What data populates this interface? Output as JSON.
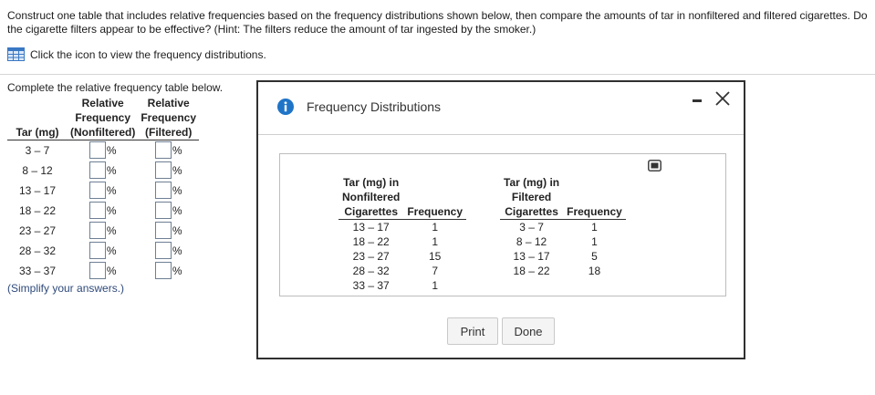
{
  "question": {
    "text": "Construct one table that includes relative frequencies based on the frequency distributions shown below, then compare the amounts of tar in nonfiltered and filtered cigarettes. Do the cigarette filters appear to be effective? (Hint: The filters reduce the amount of tar ingested by the smoker.)",
    "icon_prompt": "Click the icon to view the frequency distributions.",
    "icon": "table-grid-icon"
  },
  "rel_table": {
    "instruction": "Complete the relative frequency table below.",
    "headers": {
      "rel1": "Relative",
      "rel2": "Relative",
      "freq1": "Frequency",
      "freq2": "Frequency",
      "class": "Tar (mg)",
      "nonfiltered": "(Nonfiltered)",
      "filtered": "(Filtered)"
    },
    "rows": [
      {
        "class": "3 – 7",
        "nonfiltered": "",
        "filtered": ""
      },
      {
        "class": "8 – 12",
        "nonfiltered": "",
        "filtered": ""
      },
      {
        "class": "13 – 17",
        "nonfiltered": "",
        "filtered": ""
      },
      {
        "class": "18 – 22",
        "nonfiltered": "",
        "filtered": ""
      },
      {
        "class": "23 – 27",
        "nonfiltered": "",
        "filtered": ""
      },
      {
        "class": "28 – 32",
        "nonfiltered": "",
        "filtered": ""
      },
      {
        "class": "33 – 37",
        "nonfiltered": "",
        "filtered": ""
      }
    ],
    "unit": "%",
    "simplify": "(Simplify your answers.)"
  },
  "dialog": {
    "title": "Frequency Distributions",
    "icons": {
      "info": "info-icon",
      "minimize": "minimize-icon",
      "close": "close-icon",
      "expand": "expand-icon"
    },
    "nonfiltered": {
      "col1": [
        "Tar (mg) in",
        "Nonfiltered",
        "Cigarettes"
      ],
      "col2": "Frequency",
      "rows": [
        {
          "class": "13 – 17",
          "freq": "1"
        },
        {
          "class": "18 – 22",
          "freq": "1"
        },
        {
          "class": "23 – 27",
          "freq": "15"
        },
        {
          "class": "28 – 32",
          "freq": "7"
        },
        {
          "class": "33 – 37",
          "freq": "1"
        }
      ]
    },
    "filtered": {
      "col1": [
        "Tar (mg) in",
        "Filtered",
        "Cigarettes"
      ],
      "col2": "Frequency",
      "rows": [
        {
          "class": "3 – 7",
          "freq": "1"
        },
        {
          "class": "8 – 12",
          "freq": "1"
        },
        {
          "class": "13 – 17",
          "freq": "5"
        },
        {
          "class": "18 – 22",
          "freq": "18"
        }
      ]
    },
    "buttons": {
      "print": "Print",
      "done": "Done"
    }
  },
  "colors": {
    "link_text": "#2f4a7a",
    "info_blue": "#1f74c7",
    "grid_icon_blue": "#3a78c4"
  }
}
